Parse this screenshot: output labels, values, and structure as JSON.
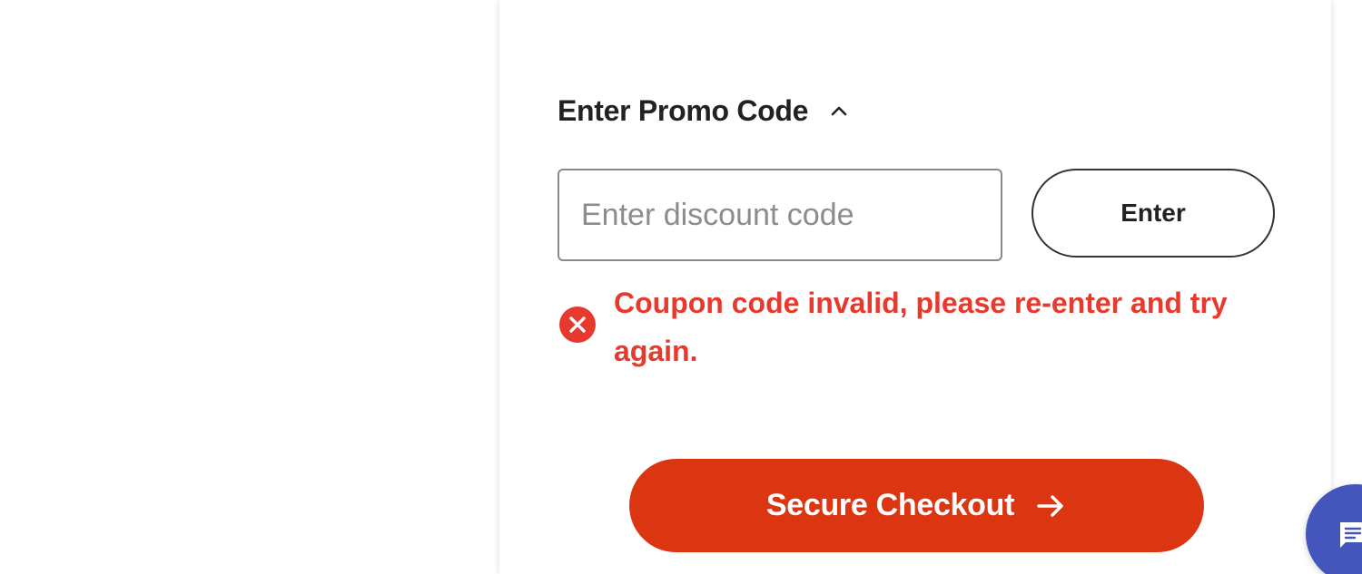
{
  "promo": {
    "title": "Enter Promo Code",
    "input_placeholder": "Enter discount code",
    "input_value": "",
    "enter_label": "Enter",
    "error_message": "Coupon code invalid, please re-enter and try again."
  },
  "checkout": {
    "label": "Secure Checkout"
  },
  "icons": {
    "toggle": "chevron-up-icon",
    "error": "error-circle-x-icon",
    "checkout": "arrow-right-icon",
    "chat": "chat-bubble-icon"
  },
  "colors": {
    "error": "#e8392e",
    "checkout_bg": "#db3512",
    "chat_bg": "#4455bb",
    "text": "#222222"
  }
}
